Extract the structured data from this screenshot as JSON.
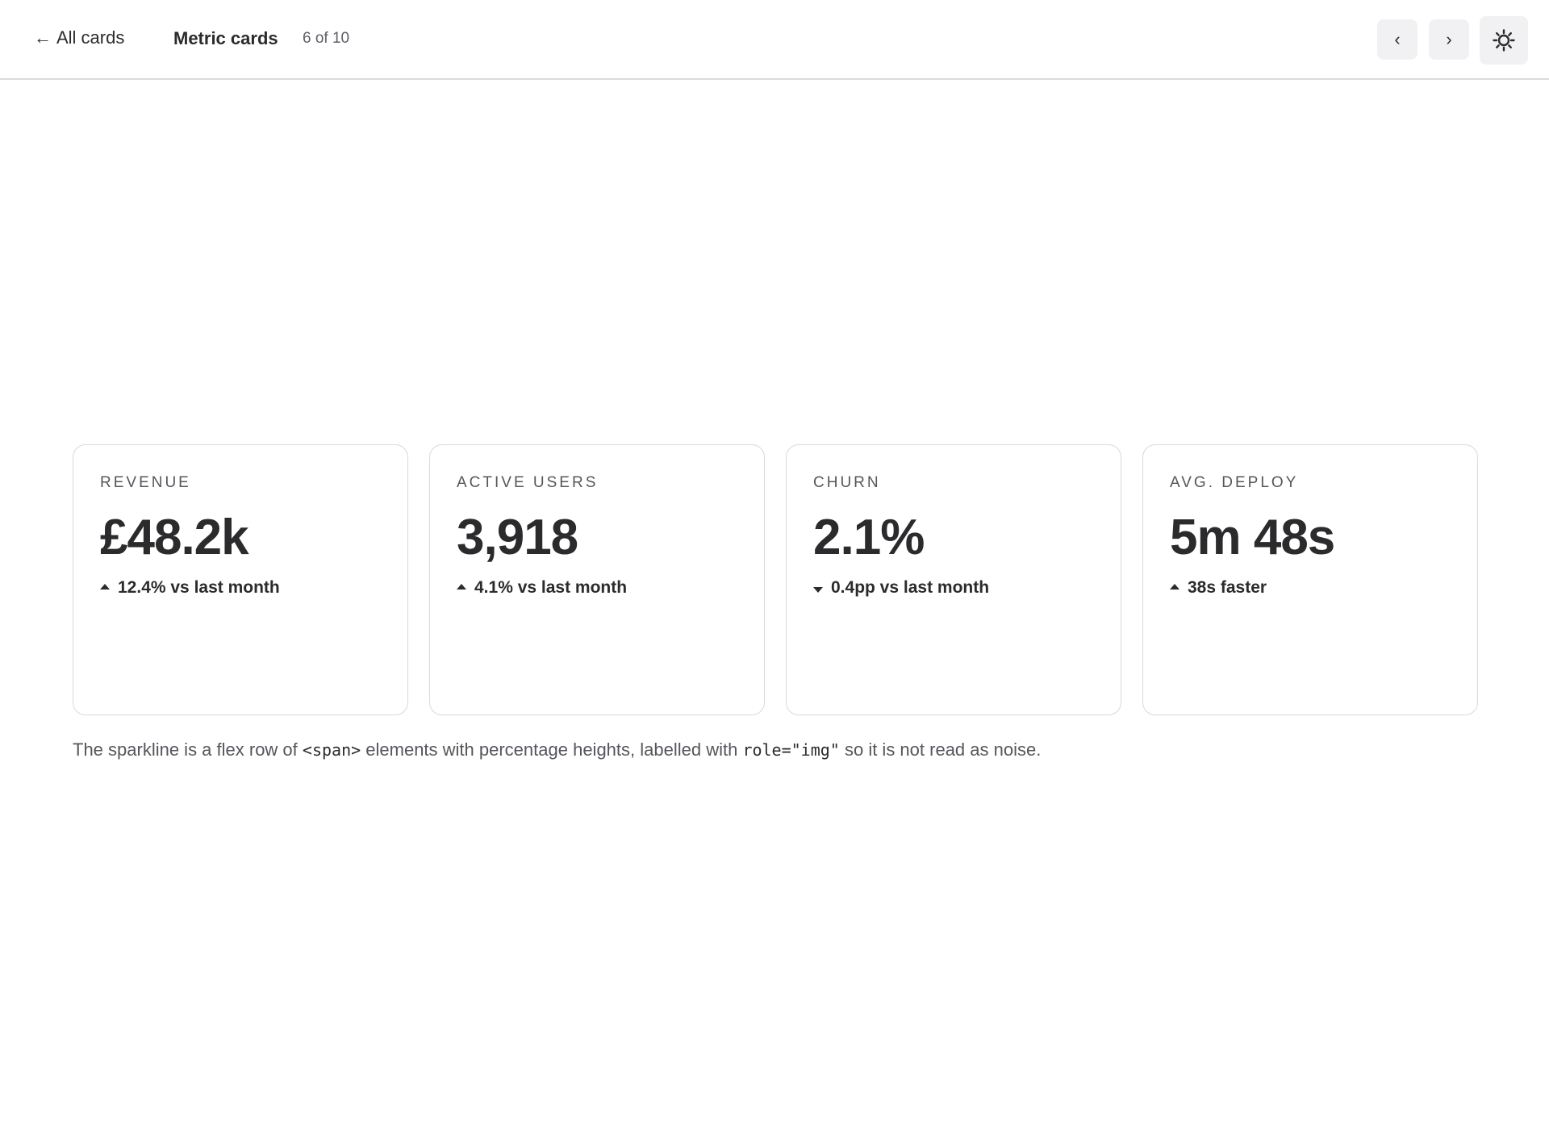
{
  "header": {
    "back_label": "All cards",
    "title": "Metric cards",
    "count": "6 of 10",
    "prev_glyph": "‹",
    "next_glyph": "›",
    "theme_icon": "sun-icon"
  },
  "cards": [
    {
      "label": "REVENUE",
      "value": "£48.2k",
      "direction": "up",
      "delta": "12.4% vs last month"
    },
    {
      "label": "ACTIVE USERS",
      "value": "3,918",
      "direction": "up",
      "delta": "4.1% vs last month"
    },
    {
      "label": "CHURN",
      "value": "2.1%",
      "direction": "down",
      "delta": "0.4pp vs last month"
    },
    {
      "label": "AVG. DEPLOY",
      "value": "5m 48s",
      "direction": "up",
      "delta": "38s faster"
    }
  ],
  "note": {
    "part1": "The sparkline is a flex row of ",
    "code1": "<span>",
    "part2": " elements with percentage heights, labelled with ",
    "code2": "role=\"img\"",
    "part3": " so it is not read as noise."
  },
  "colors": {
    "text": "#2b2b2e",
    "muted": "#55565c",
    "border": "#d9d9dd",
    "button_bg": "#f1f1f3"
  }
}
